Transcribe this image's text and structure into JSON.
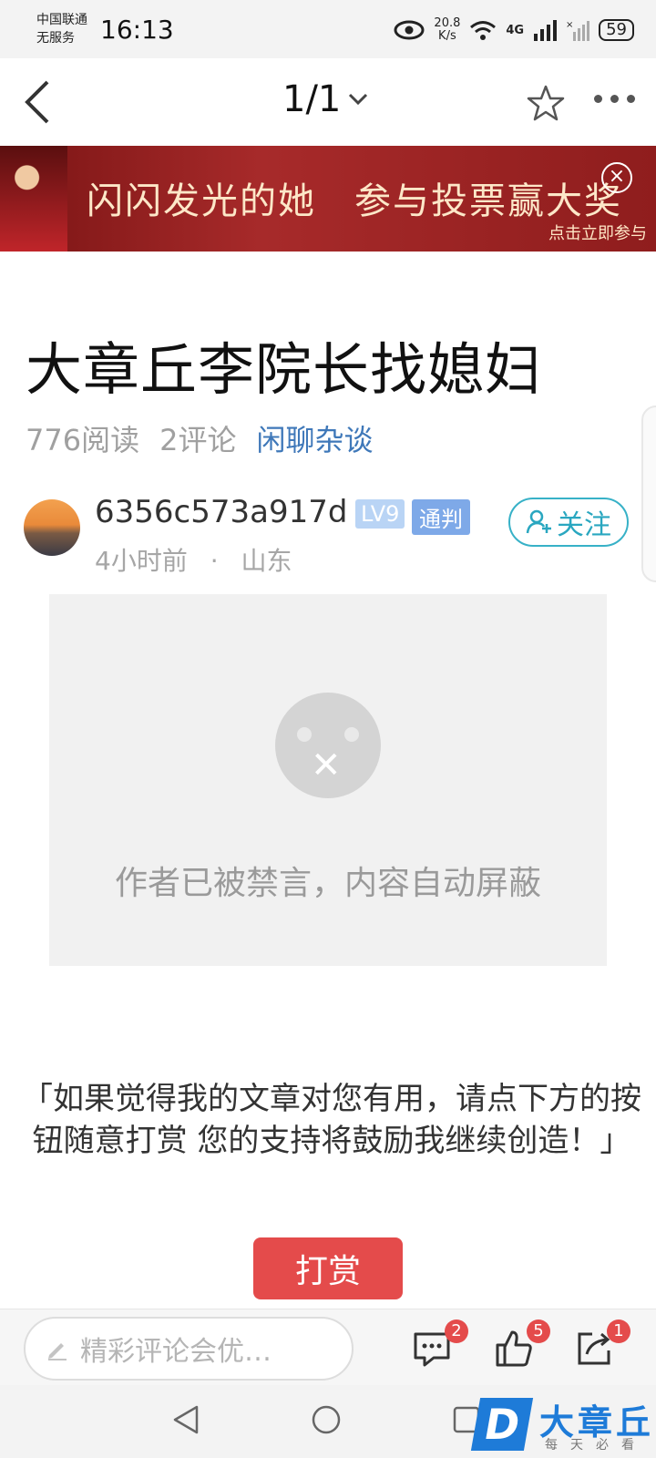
{
  "status": {
    "carrier_line1": "中国联通",
    "carrier_line2": "无服务",
    "time": "16:13",
    "net_speed": "20.8\nK/s",
    "signal_label": "4G",
    "battery": "59"
  },
  "nav": {
    "pager": "1/1"
  },
  "banner": {
    "title": "闪闪发光的她　参与投票赢大奖",
    "cta": "点击立即参与",
    "close_icon": "close-icon"
  },
  "article": {
    "title": "大章丘李院长找媳妇",
    "reads": "776阅读",
    "comments": "2评论",
    "category": "闲聊杂谈"
  },
  "author": {
    "name": "6356c573a917d",
    "level": "LV9",
    "badge": "通判",
    "time": "4小时前",
    "separator": "·",
    "location": "山东",
    "follow": "关注"
  },
  "blocked": {
    "message": "作者已被禁言，内容自动屏蔽"
  },
  "tip": {
    "text": "「如果觉得我的文章对您有用，请点下方的按钮随意打赏 您的支持将鼓励我继续创造！」"
  },
  "reward": {
    "label": "打赏"
  },
  "bottom": {
    "comment_placeholder": "精彩评论会优…",
    "comment_count": "2",
    "like_count": "5",
    "share_count": "1"
  },
  "watermark": {
    "name": "大章丘",
    "letter": "D",
    "sub": "每天必看"
  }
}
